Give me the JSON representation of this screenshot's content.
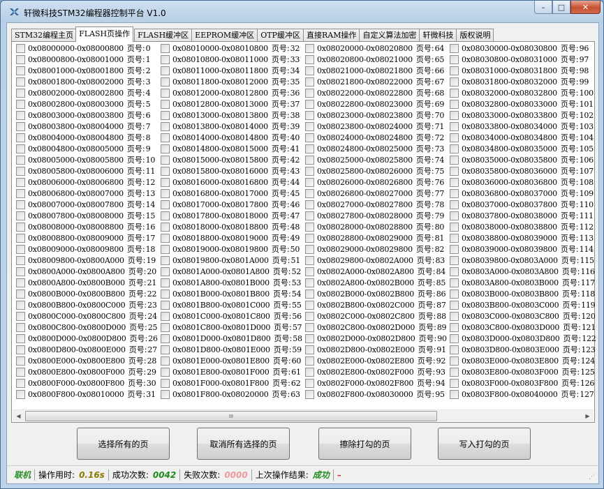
{
  "window": {
    "title": "轩微科技STM32编程器控制平台  V1.0",
    "controls": {
      "minimize": "–",
      "maximize": "□",
      "close": "✕"
    }
  },
  "tabs": [
    {
      "label": "STM32编程主页",
      "active": false
    },
    {
      "label": "FLASH页操作",
      "active": true
    },
    {
      "label": "FLASH缓冲区",
      "active": false
    },
    {
      "label": "EEPROM缓冲区",
      "active": false
    },
    {
      "label": "OTP缓冲区",
      "active": false
    },
    {
      "label": "直接RAM操作",
      "active": false
    },
    {
      "label": "自定义算法加密",
      "active": false
    },
    {
      "label": "轩微科技",
      "active": false
    },
    {
      "label": "版权说明",
      "active": false
    }
  ],
  "pages": {
    "page_label": "页号:",
    "items": [
      {
        "range": "0x08000000-0x08000800",
        "page": "0"
      },
      {
        "range": "0x08000800-0x08001000",
        "page": "1"
      },
      {
        "range": "0x08001000-0x08001800",
        "page": "2"
      },
      {
        "range": "0x08001800-0x08002000",
        "page": "3"
      },
      {
        "range": "0x08002000-0x08002800",
        "page": "4"
      },
      {
        "range": "0x08002800-0x08003000",
        "page": "5"
      },
      {
        "range": "0x08003000-0x08003800",
        "page": "6"
      },
      {
        "range": "0x08003800-0x08004000",
        "page": "7"
      },
      {
        "range": "0x08004000-0x08004800",
        "page": "8"
      },
      {
        "range": "0x08004800-0x08005000",
        "page": "9"
      },
      {
        "range": "0x08005000-0x08005800",
        "page": "10"
      },
      {
        "range": "0x08005800-0x08006000",
        "page": "11"
      },
      {
        "range": "0x08006000-0x08006800",
        "page": "12"
      },
      {
        "range": "0x08006800-0x08007000",
        "page": "13"
      },
      {
        "range": "0x08007000-0x08007800",
        "page": "14"
      },
      {
        "range": "0x08007800-0x08008000",
        "page": "15"
      },
      {
        "range": "0x08008000-0x08008800",
        "page": "16"
      },
      {
        "range": "0x08008800-0x08009000",
        "page": "17"
      },
      {
        "range": "0x08009000-0x08009800",
        "page": "18"
      },
      {
        "range": "0x08009800-0x0800A000",
        "page": "19"
      },
      {
        "range": "0x0800A000-0x0800A800",
        "page": "20"
      },
      {
        "range": "0x0800A800-0x0800B000",
        "page": "21"
      },
      {
        "range": "0x0800B000-0x0800B800",
        "page": "22"
      },
      {
        "range": "0x0800B800-0x0800C000",
        "page": "23"
      },
      {
        "range": "0x0800C000-0x0800C800",
        "page": "24"
      },
      {
        "range": "0x0800C800-0x0800D000",
        "page": "25"
      },
      {
        "range": "0x0800D000-0x0800D800",
        "page": "26"
      },
      {
        "range": "0x0800D800-0x0800E000",
        "page": "27"
      },
      {
        "range": "0x0800E000-0x0800E800",
        "page": "28"
      },
      {
        "range": "0x0800E800-0x0800F000",
        "page": "29"
      },
      {
        "range": "0x0800F000-0x0800F800",
        "page": "30"
      },
      {
        "range": "0x0800F800-0x08010000",
        "page": "31"
      },
      {
        "range": "0x08010000-0x08010800",
        "page": "32"
      },
      {
        "range": "0x08010800-0x08011000",
        "page": "33"
      },
      {
        "range": "0x08011000-0x08011800",
        "page": "34"
      },
      {
        "range": "0x08011800-0x08012000",
        "page": "35"
      },
      {
        "range": "0x08012000-0x08012800",
        "page": "36"
      },
      {
        "range": "0x08012800-0x08013000",
        "page": "37"
      },
      {
        "range": "0x08013000-0x08013800",
        "page": "38"
      },
      {
        "range": "0x08013800-0x08014000",
        "page": "39"
      },
      {
        "range": "0x08014000-0x08014800",
        "page": "40"
      },
      {
        "range": "0x08014800-0x08015000",
        "page": "41"
      },
      {
        "range": "0x08015000-0x08015800",
        "page": "42"
      },
      {
        "range": "0x08015800-0x08016000",
        "page": "43"
      },
      {
        "range": "0x08016000-0x08016800",
        "page": "44"
      },
      {
        "range": "0x08016800-0x08017000",
        "page": "45"
      },
      {
        "range": "0x08017000-0x08017800",
        "page": "46"
      },
      {
        "range": "0x08017800-0x08018000",
        "page": "47"
      },
      {
        "range": "0x08018000-0x08018800",
        "page": "48"
      },
      {
        "range": "0x08018800-0x08019000",
        "page": "49"
      },
      {
        "range": "0x08019000-0x08019800",
        "page": "50"
      },
      {
        "range": "0x08019800-0x0801A000",
        "page": "51"
      },
      {
        "range": "0x0801A000-0x0801A800",
        "page": "52"
      },
      {
        "range": "0x0801A800-0x0801B000",
        "page": "53"
      },
      {
        "range": "0x0801B000-0x0801B800",
        "page": "54"
      },
      {
        "range": "0x0801B800-0x0801C000",
        "page": "55"
      },
      {
        "range": "0x0801C000-0x0801C800",
        "page": "56"
      },
      {
        "range": "0x0801C800-0x0801D000",
        "page": "57"
      },
      {
        "range": "0x0801D000-0x0801D800",
        "page": "58"
      },
      {
        "range": "0x0801D800-0x0801E000",
        "page": "59"
      },
      {
        "range": "0x0801E000-0x0801E800",
        "page": "60"
      },
      {
        "range": "0x0801E800-0x0801F000",
        "page": "61"
      },
      {
        "range": "0x0801F000-0x0801F800",
        "page": "62"
      },
      {
        "range": "0x0801F800-0x08020000",
        "page": "63"
      },
      {
        "range": "0x08020000-0x08020800",
        "page": "64"
      },
      {
        "range": "0x08020800-0x08021000",
        "page": "65"
      },
      {
        "range": "0x08021000-0x08021800",
        "page": "66"
      },
      {
        "range": "0x08021800-0x08022000",
        "page": "67"
      },
      {
        "range": "0x08022000-0x08022800",
        "page": "68"
      },
      {
        "range": "0x08022800-0x08023000",
        "page": "69"
      },
      {
        "range": "0x08023000-0x08023800",
        "page": "70"
      },
      {
        "range": "0x08023800-0x08024000",
        "page": "71"
      },
      {
        "range": "0x08024000-0x08024800",
        "page": "72"
      },
      {
        "range": "0x08024800-0x08025000",
        "page": "73"
      },
      {
        "range": "0x08025000-0x08025800",
        "page": "74"
      },
      {
        "range": "0x08025800-0x08026000",
        "page": "75"
      },
      {
        "range": "0x08026000-0x08026800",
        "page": "76"
      },
      {
        "range": "0x08026800-0x08027000",
        "page": "77"
      },
      {
        "range": "0x08027000-0x08027800",
        "page": "78"
      },
      {
        "range": "0x08027800-0x08028000",
        "page": "79"
      },
      {
        "range": "0x08028000-0x08028800",
        "page": "80"
      },
      {
        "range": "0x08028800-0x08029000",
        "page": "81"
      },
      {
        "range": "0x08029000-0x08029800",
        "page": "82"
      },
      {
        "range": "0x08029800-0x0802A000",
        "page": "83"
      },
      {
        "range": "0x0802A000-0x0802A800",
        "page": "84"
      },
      {
        "range": "0x0802A800-0x0802B000",
        "page": "85"
      },
      {
        "range": "0x0802B000-0x0802B800",
        "page": "86"
      },
      {
        "range": "0x0802B800-0x0802C000",
        "page": "87"
      },
      {
        "range": "0x0802C000-0x0802C800",
        "page": "88"
      },
      {
        "range": "0x0802C800-0x0802D000",
        "page": "89"
      },
      {
        "range": "0x0802D000-0x0802D800",
        "page": "90"
      },
      {
        "range": "0x0802D800-0x0802E000",
        "page": "91"
      },
      {
        "range": "0x0802E000-0x0802E800",
        "page": "92"
      },
      {
        "range": "0x0802E800-0x0802F000",
        "page": "93"
      },
      {
        "range": "0x0802F000-0x0802F800",
        "page": "94"
      },
      {
        "range": "0x0802F800-0x08030000",
        "page": "95"
      },
      {
        "range": "0x08030000-0x08030800",
        "page": "96"
      },
      {
        "range": "0x08030800-0x08031000",
        "page": "97"
      },
      {
        "range": "0x08031000-0x08031800",
        "page": "98"
      },
      {
        "range": "0x08031800-0x08032000",
        "page": "99"
      },
      {
        "range": "0x08032000-0x08032800",
        "page": "100"
      },
      {
        "range": "0x08032800-0x08033000",
        "page": "101"
      },
      {
        "range": "0x08033000-0x08033800",
        "page": "102"
      },
      {
        "range": "0x08033800-0x08034000",
        "page": "103"
      },
      {
        "range": "0x08034000-0x08034800",
        "page": "104"
      },
      {
        "range": "0x08034800-0x08035000",
        "page": "105"
      },
      {
        "range": "0x08035000-0x08035800",
        "page": "106"
      },
      {
        "range": "0x08035800-0x08036000",
        "page": "107"
      },
      {
        "range": "0x08036000-0x08036800",
        "page": "108"
      },
      {
        "range": "0x08036800-0x08037000",
        "page": "109"
      },
      {
        "range": "0x08037000-0x08037800",
        "page": "110"
      },
      {
        "range": "0x08037800-0x08038000",
        "page": "111"
      },
      {
        "range": "0x08038000-0x08038800",
        "page": "112"
      },
      {
        "range": "0x08038800-0x08039000",
        "page": "113"
      },
      {
        "range": "0x08039000-0x08039800",
        "page": "114"
      },
      {
        "range": "0x08039800-0x0803A000",
        "page": "115"
      },
      {
        "range": "0x0803A000-0x0803A800",
        "page": "116"
      },
      {
        "range": "0x0803A800-0x0803B000",
        "page": "117"
      },
      {
        "range": "0x0803B000-0x0803B800",
        "page": "118"
      },
      {
        "range": "0x0803B800-0x0803C000",
        "page": "119"
      },
      {
        "range": "0x0803C000-0x0803C800",
        "page": "120"
      },
      {
        "range": "0x0803C800-0x0803D000",
        "page": "121"
      },
      {
        "range": "0x0803D000-0x0803D800",
        "page": "122"
      },
      {
        "range": "0x0803D800-0x0803E000",
        "page": "123"
      },
      {
        "range": "0x0803E000-0x0803E800",
        "page": "124"
      },
      {
        "range": "0x0803E800-0x0803F000",
        "page": "125"
      },
      {
        "range": "0x0803F000-0x0803F800",
        "page": "126"
      },
      {
        "range": "0x0803F800-0x08040000",
        "page": "127"
      }
    ]
  },
  "scrollbar": {
    "thumb_grip": "III"
  },
  "buttons": {
    "select_all": "选择所有的页",
    "deselect_all": "取消所有选择的页",
    "erase_checked": "擦除打勾的页",
    "write_checked": "写入打勾的页"
  },
  "status": {
    "connection": "联机",
    "time_label": "操作用时:",
    "time_value": "0.16s",
    "success_label": "成功次数:",
    "success_value": "0042",
    "fail_label": "失败次数:",
    "fail_value": "0000",
    "result_label": "上次操作结果:",
    "result_value": "成功",
    "trailing": "–"
  },
  "colors": {
    "online": "#2a8f2a",
    "time": "#8a7a00",
    "success": "#1c8a1c",
    "fail": "#ef9a9a",
    "close_button": "#c75132"
  }
}
